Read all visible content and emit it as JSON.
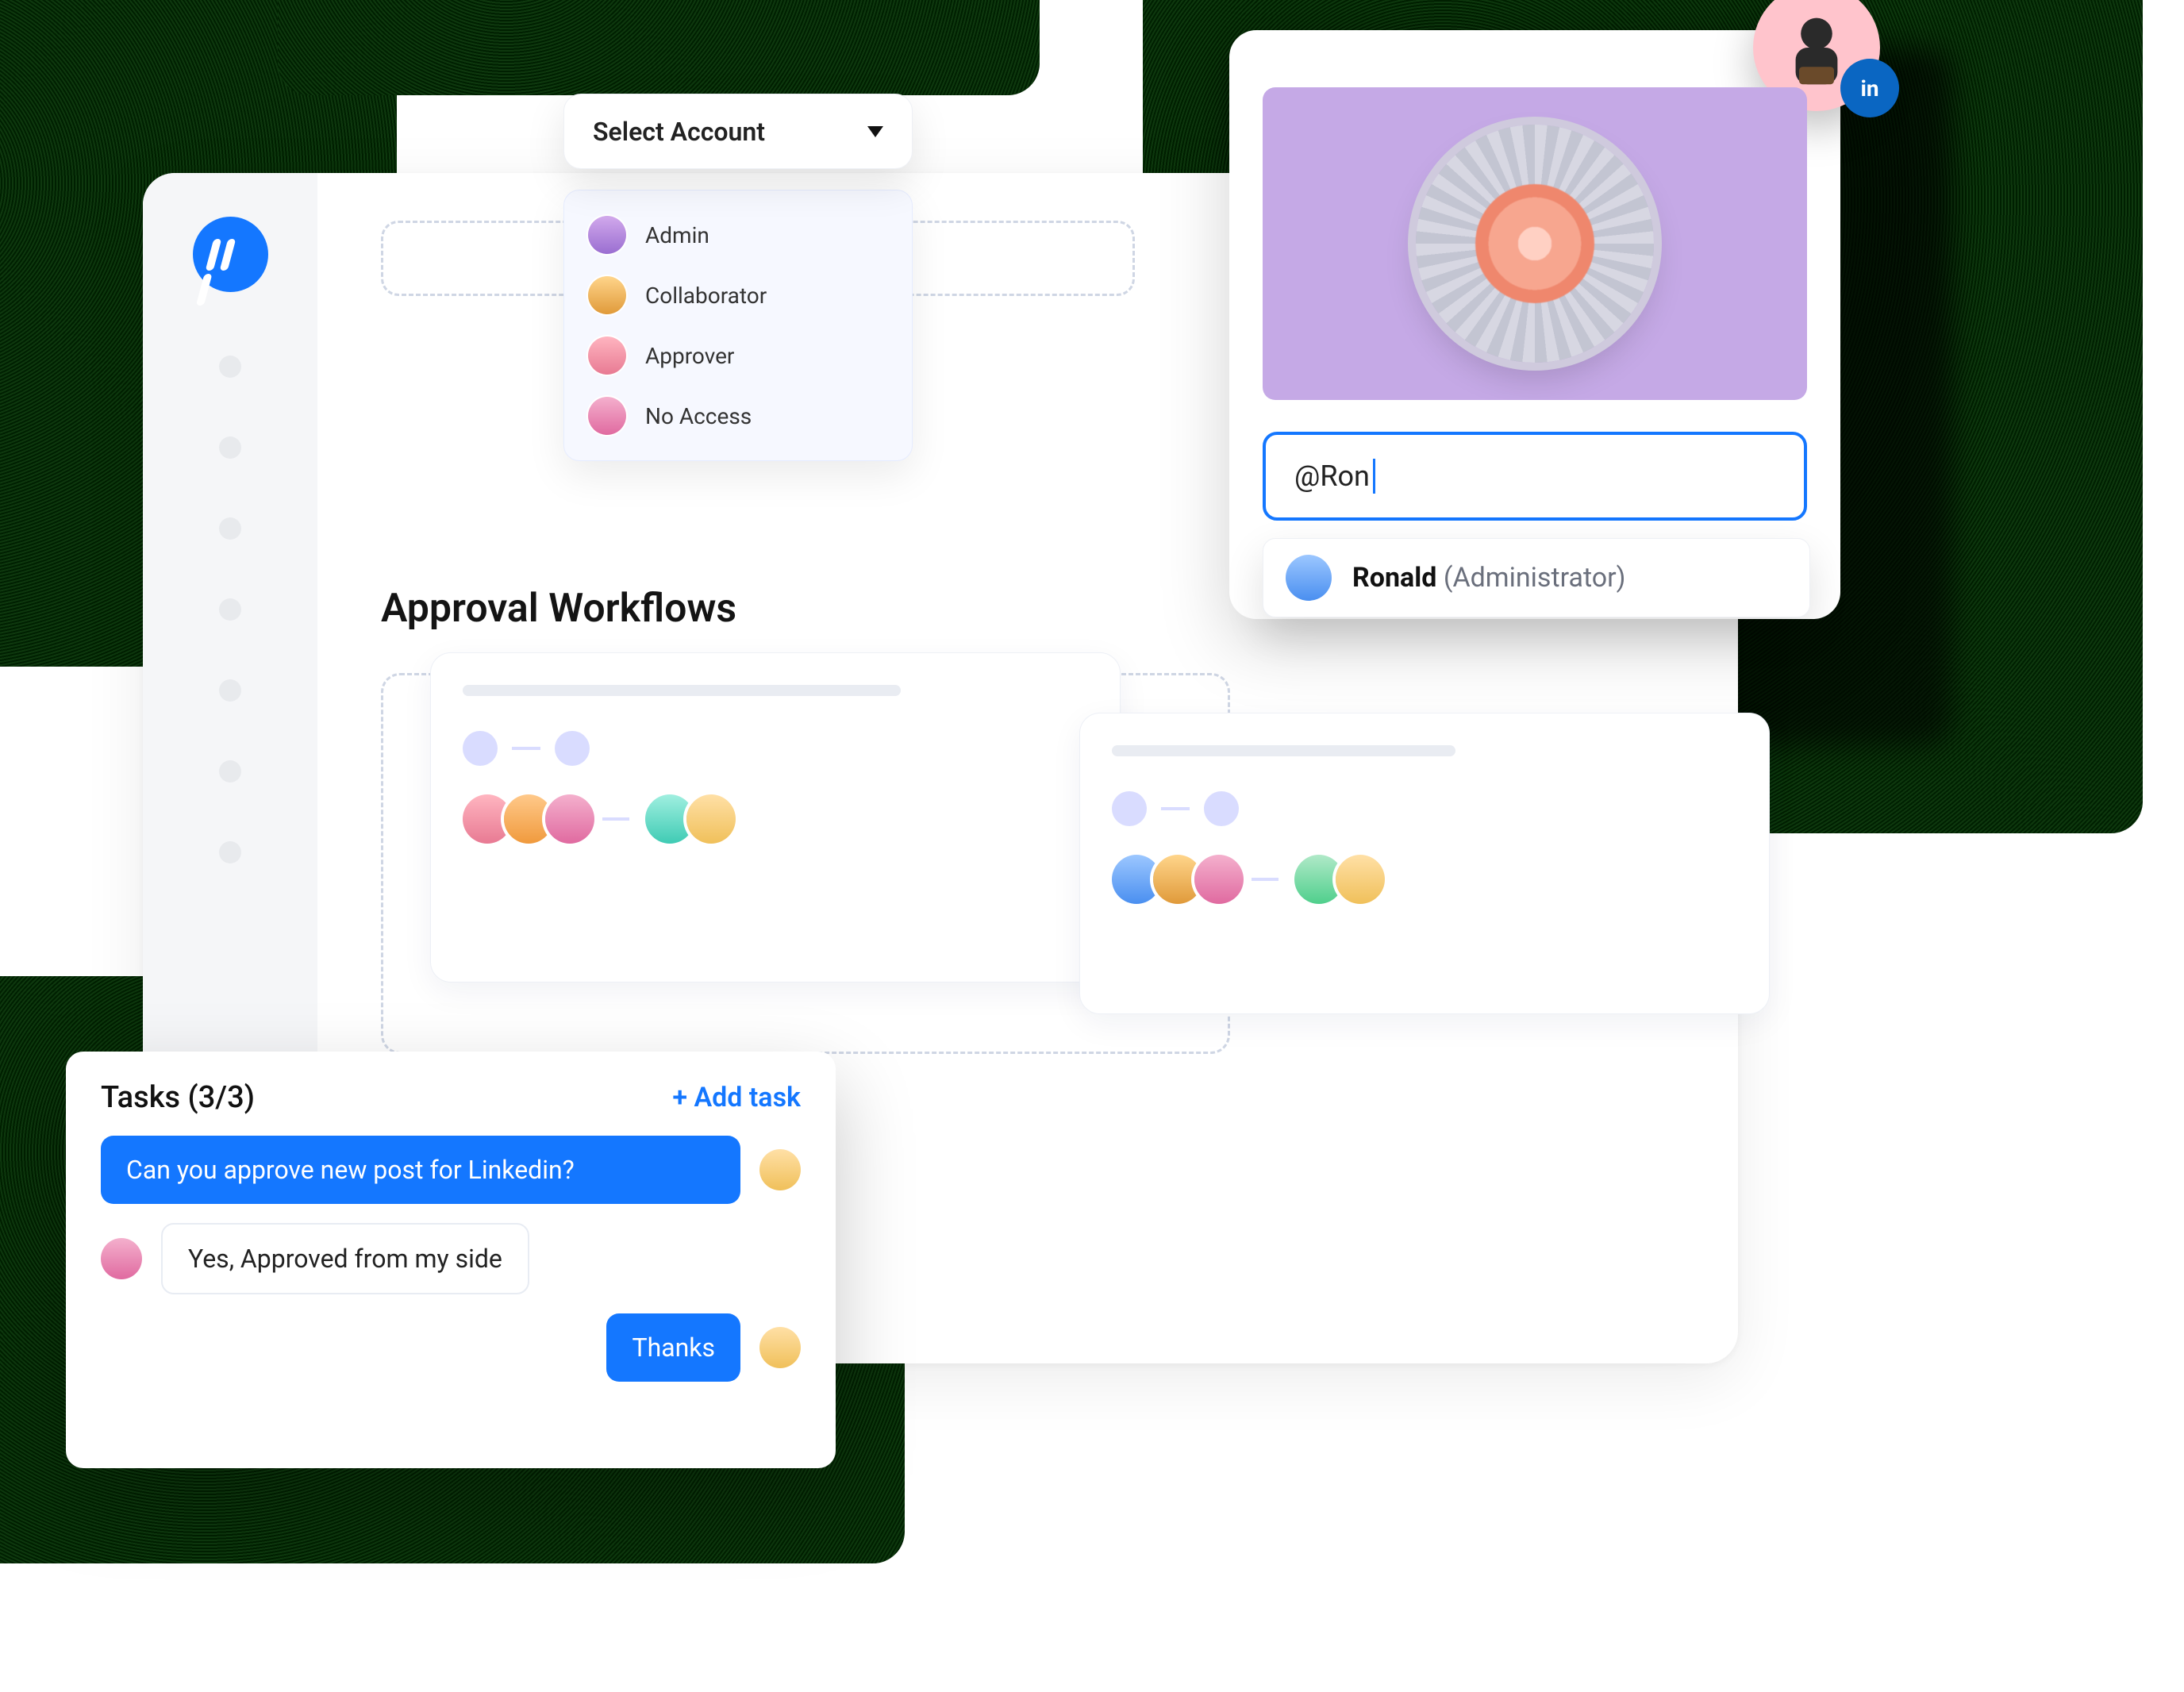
{
  "select": {
    "label": "Select Account"
  },
  "roles": [
    {
      "label": "Admin"
    },
    {
      "label": "Collaborator"
    },
    {
      "label": "Approver"
    },
    {
      "label": "No Access"
    }
  ],
  "section": {
    "title": "Approval Workflows"
  },
  "mention": {
    "input_value": "@Ron",
    "suggestion_name": "Ronald",
    "suggestion_role": "(Administrator)",
    "linkedin_glyph": "in"
  },
  "tasks": {
    "title": "Tasks (3/3)",
    "add": "+ Add task",
    "m1": "Can you approve new post for Linkedin?",
    "m2": "Yes, Approved from my side",
    "m3": "Thanks"
  },
  "colors": {
    "accent": "#1477ff",
    "media_bg": "#c5a9e6",
    "linkedin": "#0a66c2"
  }
}
